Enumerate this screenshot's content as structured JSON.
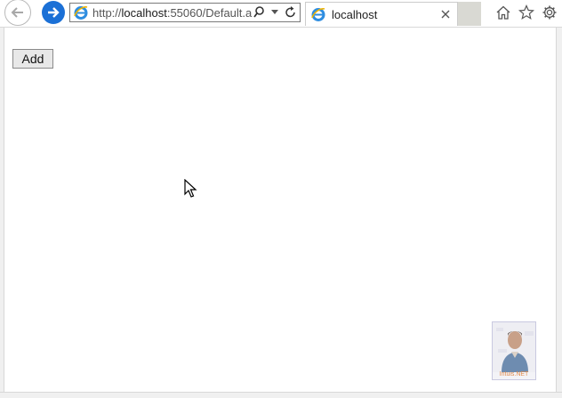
{
  "browser": {
    "address_url_prefix": "http://",
    "address_url_host": "localhost",
    "address_url_rest": ":55060/Default.a",
    "tab_title": "localhost"
  },
  "page": {
    "add_button_label": "Add"
  },
  "watermark": {
    "text": "Intuis.NET"
  },
  "colors": {
    "accent_blue": "#1b70d6",
    "tab_strip_gray": "#d9d9d3"
  },
  "icons": {
    "back": "back-arrow-icon",
    "forward": "forward-arrow-icon",
    "ie": "internet-explorer-icon",
    "search": "search-icon",
    "dropdown": "chevron-down-icon",
    "refresh": "refresh-icon",
    "close": "close-icon",
    "home": "home-icon",
    "favorites": "star-icon",
    "settings": "gear-icon",
    "cursor": "mouse-pointer-icon"
  }
}
